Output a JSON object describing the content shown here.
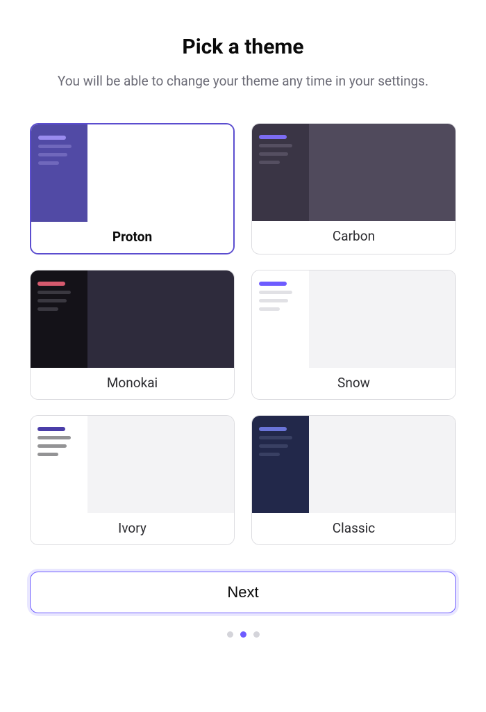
{
  "heading": "Pick a theme",
  "subheading": "You will be able to change your theme any time in your settings.",
  "themes": [
    {
      "name": "Proton",
      "selected": true,
      "sidebar_bg": "#514aa5",
      "main_bg": "#ffffff",
      "accent": "#9a8cf0",
      "line": "#8b82cf"
    },
    {
      "name": "Carbon",
      "selected": false,
      "sidebar_bg": "#3a3545",
      "main_bg": "#504a5c",
      "accent": "#7c6cf2",
      "line": "#6c6578"
    },
    {
      "name": "Monokai",
      "selected": false,
      "sidebar_bg": "#141218",
      "main_bg": "#2e2b3c",
      "accent": "#d65a6e",
      "line": "#5a5763"
    },
    {
      "name": "Snow",
      "selected": false,
      "sidebar_bg": "#ffffff",
      "main_bg": "#f3f3f5",
      "accent": "#6e5cff",
      "line": "#c9c9d0"
    },
    {
      "name": "Ivory",
      "selected": false,
      "sidebar_bg": "#ffffff",
      "main_bg": "#f3f3f5",
      "accent": "#4a3da8",
      "line": "#3a3a3e"
    },
    {
      "name": "Classic",
      "selected": false,
      "sidebar_bg": "#22284a",
      "main_bg": "#f3f3f5",
      "accent": "#6a74d8",
      "line": "#4c5378"
    }
  ],
  "next_label": "Next",
  "pager": {
    "total": 3,
    "active_index": 1
  }
}
